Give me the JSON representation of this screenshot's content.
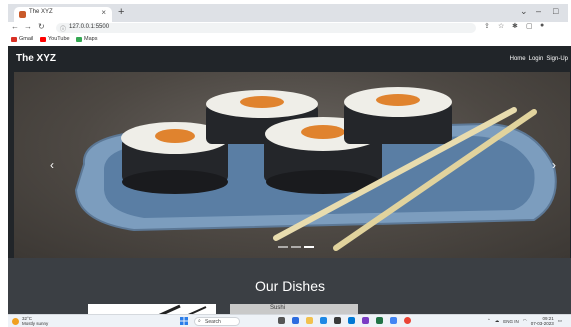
{
  "browser": {
    "tab_title": "The XYZ",
    "tab_close": "×",
    "new_tab": "+",
    "window_controls": [
      "⌄",
      "–",
      "□"
    ],
    "url": "127.0.0.1:5500",
    "nav_icons": [
      "back-icon",
      "forward-icon",
      "reload-icon"
    ],
    "bookmarks": [
      {
        "label": "Gmail",
        "color": "#d93025"
      },
      {
        "label": "YouTube",
        "color": "#ff0000"
      },
      {
        "label": "Maps",
        "color": "#34a853"
      }
    ]
  },
  "site": {
    "brand": "The XYZ",
    "nav": [
      {
        "label": "Home"
      },
      {
        "label": "Login"
      },
      {
        "label": "Sign-Up"
      }
    ],
    "carousel": {
      "prev": "‹",
      "next": "›",
      "indicators": 3,
      "active_index": 2
    },
    "section_title": "Our Dishes",
    "card2_text": "Sushi"
  },
  "taskbar": {
    "weather_temp": "32°C",
    "weather_desc": "Mostly sunny",
    "search": "Search",
    "lang": "ENG IN",
    "time": "09:21",
    "date": "07-03-2023"
  },
  "colors": {
    "navbar": "#212529",
    "section_bg": "#3b3f44",
    "accent": "#ffffff"
  }
}
